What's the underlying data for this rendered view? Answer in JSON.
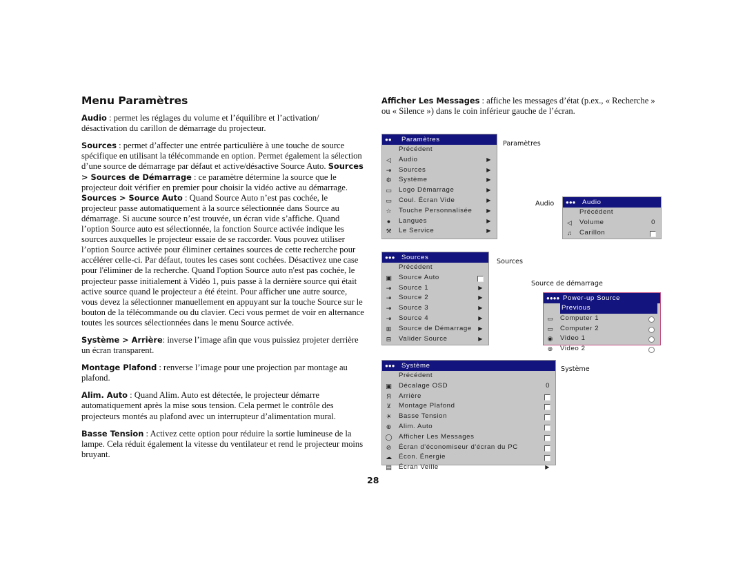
{
  "title": "Menu Paramètres",
  "left": [
    [
      {
        "b": 1,
        "t": "Audio"
      },
      {
        "t": " : permet les réglages du volume et l’équilibre et l’activation/ désactivation du carillon de démarrage du projecteur."
      }
    ],
    [
      {
        "b": 1,
        "t": "Sources"
      },
      {
        "t": " : permet d’affecter une entrée particulière à une touche de source spécifique en utilisant la télécommande en option. Permet également la sélection d’une source de démarrage par défaut et active/désactive Source Auto. "
      },
      {
        "b": 1,
        "t": "Sources > Sources de Démarrage"
      },
      {
        "t": " : ce paramètre détermine la source que le projecteur doit vérifier en premier pour choisir la vidéo active au démarrage. "
      },
      {
        "b": 1,
        "t": "Sources > Source Auto"
      },
      {
        "t": " : Quand Source Auto n’est pas cochée, le projecteur passe automatiquement à la source sélectionnée dans Source au démarrage. Si aucune source n’est trouvée, un écran vide s’affiche. Quand l’option Source auto est sélectionnée, la fonction Source activée indique les sources auxquelles le projecteur essaie de se raccorder. Vous pouvez utiliser l’option Source activée pour éliminer certaines sources de cette recherche pour accélérer celle-ci. Par défaut, toutes les cases sont cochées. Désactivez une case pour l'éliminer de la recherche. Quand l'option Source auto n'est pas cochée, le projecteur passe initialement à Vidéo 1, puis passe à la dernière source qui était active source quand le projecteur a été éteint. Pour afficher une autre source, vous devez la sélectionner manuellement en appuyant sur la touche Source sur le bouton de la télécommande ou du clavier. Ceci vous permet de voir en alternance toutes les sources sélectionnées dans le menu Source activée."
      }
    ],
    [
      {
        "b": 1,
        "t": "Système > Arrière"
      },
      {
        "t": ": inverse l’image afin que vous puissiez projeter derrière un écran transparent."
      }
    ],
    [
      {
        "b": 1,
        "t": "Montage Plafond"
      },
      {
        "t": " : renverse l’image pour une projection par montage au plafond."
      }
    ],
    [
      {
        "b": 1,
        "t": "Alim. Auto"
      },
      {
        "t": " : Quand Alim. Auto est détectée, le projecteur démarre automatiquement après la mise sous tension. Cela permet le contrôle des projecteurs montés au plafond avec un interrupteur d’alimentation mural."
      }
    ],
    [
      {
        "b": 1,
        "t": "Basse Tension"
      },
      {
        "t": " : Activez cette option pour réduire la sortie lumineuse de la lampe. Cela réduit également la vitesse du ventilateur et rend le projecteur moins bruyant."
      }
    ]
  ],
  "right": [
    [
      {
        "b": 1,
        "t": "Afficher Les Messages"
      },
      {
        "t": " : affiche les messages d’état (p.ex., « Recherche » ou « Silence ») dans le coin inférieur gauche de l’écran."
      }
    ]
  ],
  "labels": {
    "parametres": "Paramètres",
    "audio": "Audio",
    "sources": "Sources",
    "source_demarrage": "Source de démarrage",
    "systeme": "Système"
  },
  "accent_color": "#14147e",
  "menus": {
    "parametres": {
      "dots": "●●",
      "title": "Paramètres",
      "items": [
        {
          "label": "Précédent"
        },
        {
          "icon": "speaker",
          "label": "Audio",
          "ctl": "arrow"
        },
        {
          "icon": "source",
          "label": "Sources",
          "ctl": "arrow"
        },
        {
          "icon": "system",
          "label": "Système",
          "ctl": "arrow"
        },
        {
          "icon": "logo",
          "label": "Logo Démarrage",
          "ctl": "arrow"
        },
        {
          "icon": "blank-screen",
          "label": "Coul. Écran Vide",
          "ctl": "arrow"
        },
        {
          "icon": "star",
          "label": "Touche Personnalisée",
          "ctl": "arrow"
        },
        {
          "icon": "globe",
          "label": "Langues",
          "ctl": "arrow"
        },
        {
          "icon": "wrench",
          "label": "Le Service",
          "ctl": "arrow"
        }
      ]
    },
    "audio": {
      "dots": "●●●",
      "title": "Audio",
      "items": [
        {
          "label": "Précédent"
        },
        {
          "icon": "volume",
          "label": "Volume",
          "ctl": "value",
          "value": "0"
        },
        {
          "icon": "music",
          "label": "Carillon",
          "ctl": "checkbox",
          "checked": false
        }
      ]
    },
    "sources": {
      "dots": "●●●",
      "title": "Sources",
      "items": [
        {
          "label": "Précédent"
        },
        {
          "icon": "auto-source",
          "label": "Source Auto",
          "ctl": "checkbox",
          "checked": false
        },
        {
          "icon": "source",
          "label": "Source 1",
          "ctl": "arrow"
        },
        {
          "icon": "source",
          "label": "Source 2",
          "ctl": "arrow"
        },
        {
          "icon": "source",
          "label": "Source 3",
          "ctl": "arrow"
        },
        {
          "icon": "source",
          "label": "Source 4",
          "ctl": "arrow"
        },
        {
          "icon": "startup-source",
          "label": "Source de Démarrage",
          "ctl": "arrow"
        },
        {
          "icon": "enable-source",
          "label": "Valider Source",
          "ctl": "arrow"
        }
      ]
    },
    "powerup": {
      "dots": "●●●●",
      "title": "Power-up Source",
      "items": [
        {
          "label": "Previous",
          "selected": true
        },
        {
          "icon": "monitor",
          "label": "Computer 1",
          "ctl": "radio"
        },
        {
          "icon": "monitor",
          "label": "Computer 2",
          "ctl": "radio"
        },
        {
          "icon": "video",
          "label": "Video 1",
          "ctl": "radio"
        },
        {
          "icon": "svideo",
          "label": "Video 2",
          "ctl": "radio"
        }
      ]
    },
    "systeme": {
      "dots": "●●●",
      "title": "Système",
      "items": [
        {
          "label": "Précédent"
        },
        {
          "icon": "osd-offset",
          "label": "Décalage OSD",
          "ctl": "value",
          "value": "0"
        },
        {
          "icon": "rear",
          "label": "Arrière",
          "ctl": "checkbox",
          "checked": false
        },
        {
          "icon": "ceiling",
          "label": "Montage Plafond",
          "ctl": "checkbox",
          "checked": false
        },
        {
          "icon": "bulb",
          "label": "Basse Tension",
          "ctl": "checkbox",
          "checked": false
        },
        {
          "icon": "auto-power",
          "label": "Alim. Auto",
          "ctl": "checkbox",
          "checked": false
        },
        {
          "icon": "message",
          "label": "Afficher Les Messages",
          "ctl": "checkbox",
          "checked": false
        },
        {
          "icon": "screensaver",
          "label": "Écran d'économiseur d'écran du PC",
          "ctl": "checkbox",
          "checked": false
        },
        {
          "icon": "power-save",
          "label": "Écon. Énergie",
          "ctl": "checkbox",
          "checked": false
        },
        {
          "icon": "standby",
          "label": "Écran Veille",
          "ctl": "arrow"
        }
      ]
    }
  },
  "page_number": "28"
}
